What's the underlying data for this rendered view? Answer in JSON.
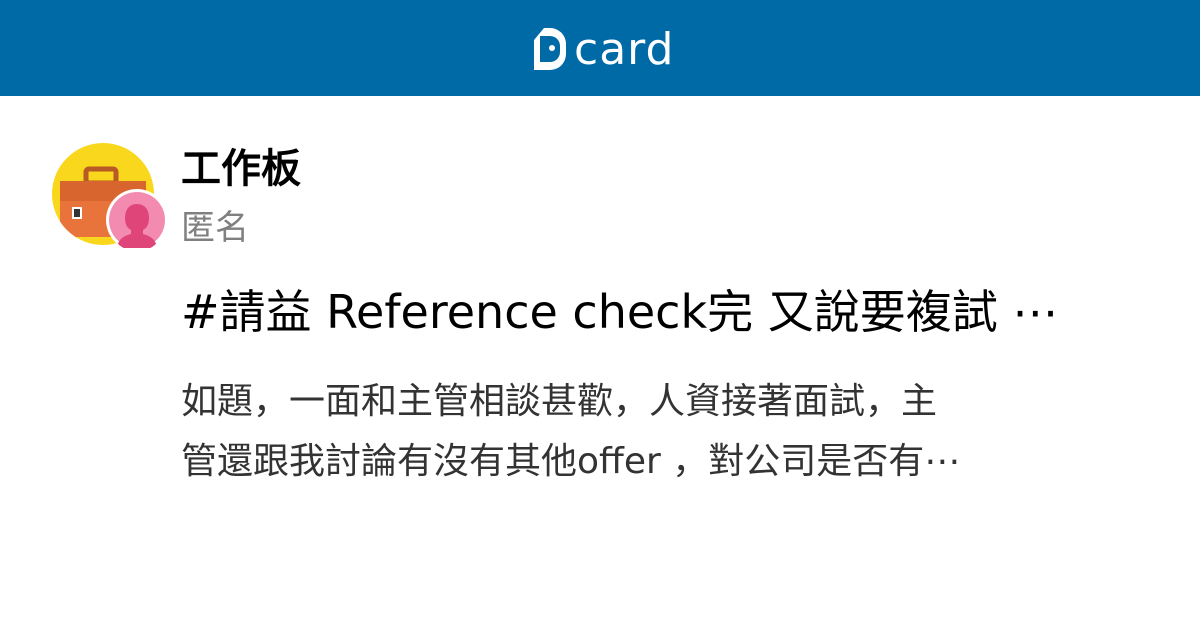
{
  "brand": {
    "name": "Dcard",
    "logo_text": "card",
    "header_color": "#006aa6"
  },
  "icons": {
    "board_avatar": "briefcase-icon",
    "user_avatar": "anonymous-female-icon"
  },
  "post": {
    "board": "工作板",
    "author": "匿名",
    "title": "#請益 Reference check完 又說要複試 ⋯",
    "excerpt_lines": [
      "如題，一面和主管相談甚歡，人資接著面試，主",
      "管還跟我討論有沒有其他offer ，對公司是否有⋯"
    ]
  },
  "colors": {
    "board_avatar_bg": "#f9d71c",
    "briefcase": "#e8743b",
    "user_avatar_bg": "#f38bb0",
    "user_silhouette": "#e0457a",
    "author_text": "#808080"
  }
}
